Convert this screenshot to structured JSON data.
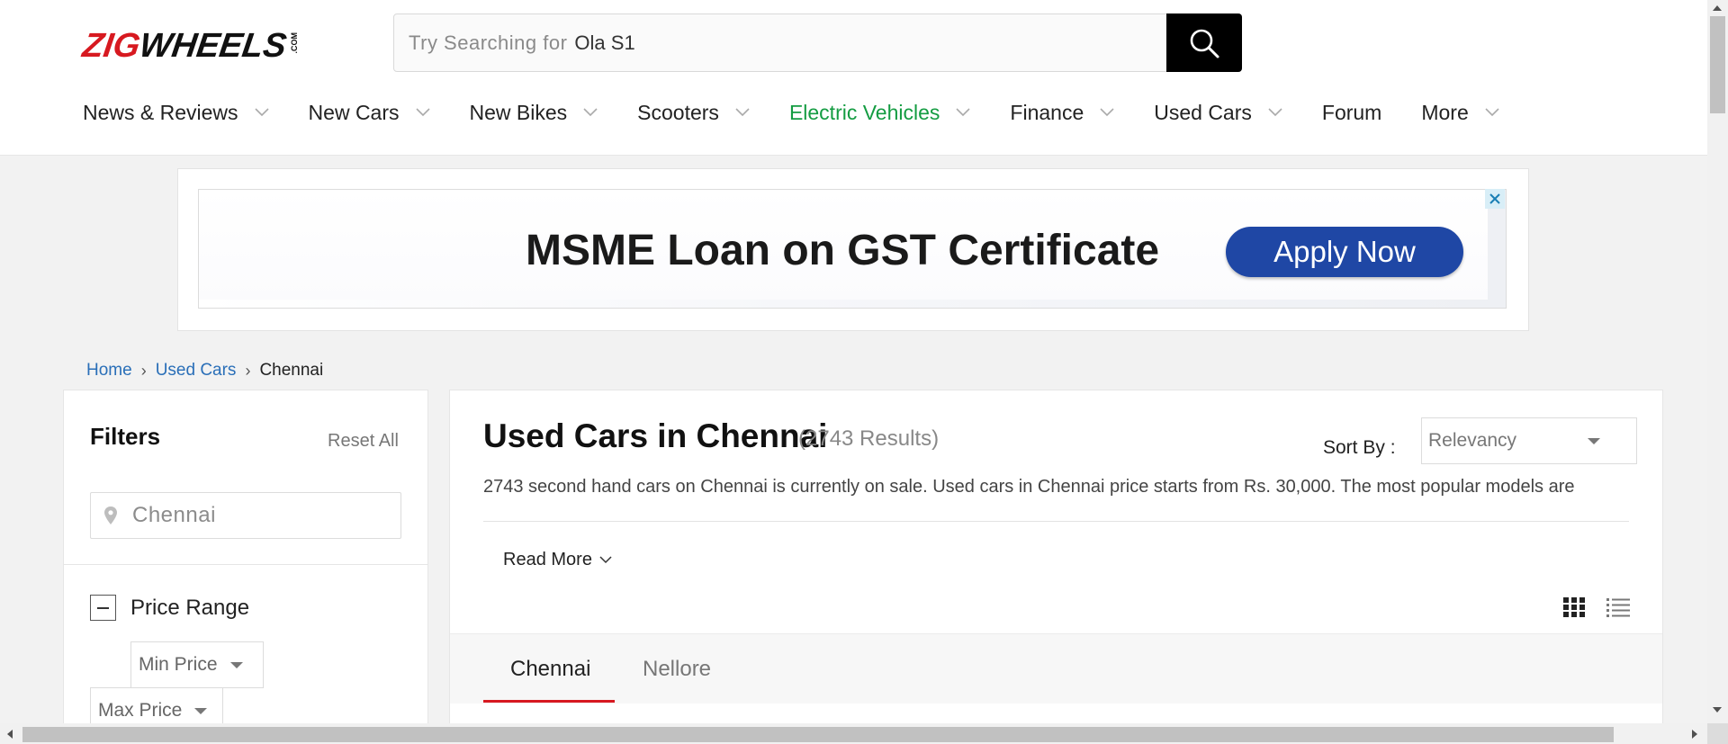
{
  "header": {
    "logo": {
      "zig": "ZIG",
      "wheels": "WHEELS",
      "com": ".COM"
    },
    "search": {
      "placeholder": "Try Searching for",
      "value": "Ola S1",
      "button_icon": "search-icon"
    },
    "nav": [
      {
        "label": "News & Reviews",
        "has_dropdown": true
      },
      {
        "label": "New Cars",
        "has_dropdown": true
      },
      {
        "label": "New Bikes",
        "has_dropdown": true
      },
      {
        "label": "Scooters",
        "has_dropdown": true
      },
      {
        "label": "Electric Vehicles",
        "has_dropdown": true,
        "color": "#149c42"
      },
      {
        "label": "Finance",
        "has_dropdown": true
      },
      {
        "label": "Used Cars",
        "has_dropdown": true
      },
      {
        "label": "Forum",
        "has_dropdown": false
      },
      {
        "label": "More",
        "has_dropdown": true
      }
    ]
  },
  "ad": {
    "headline": "MSME Loan on GST Certificate",
    "cta": "Apply Now",
    "cta_color": "#1f47a5",
    "close_icon": "close-icon"
  },
  "breadcrumb": {
    "home": "Home",
    "used_cars": "Used Cars",
    "current": "Chennai",
    "separator": "›"
  },
  "filters": {
    "title": "Filters",
    "reset": "Reset All",
    "location": "Chennai",
    "price_range": {
      "label": "Price Range",
      "min_label": "Min Price",
      "max_label": "Max Price"
    }
  },
  "listing": {
    "title": "Used Cars in Chennai",
    "count": "(2743 Results)",
    "sort_label": "Sort By :",
    "sort_value": "Relevancy",
    "description": "2743 second hand cars on Chennai is currently on sale. Used cars in Chennai price starts from Rs. 30,000. The most popular models are",
    "read_more": "Read More",
    "tabs": [
      {
        "label": "Chennai",
        "active": true
      },
      {
        "label": "Nellore",
        "active": false
      }
    ],
    "accent_color": "#d71920"
  }
}
